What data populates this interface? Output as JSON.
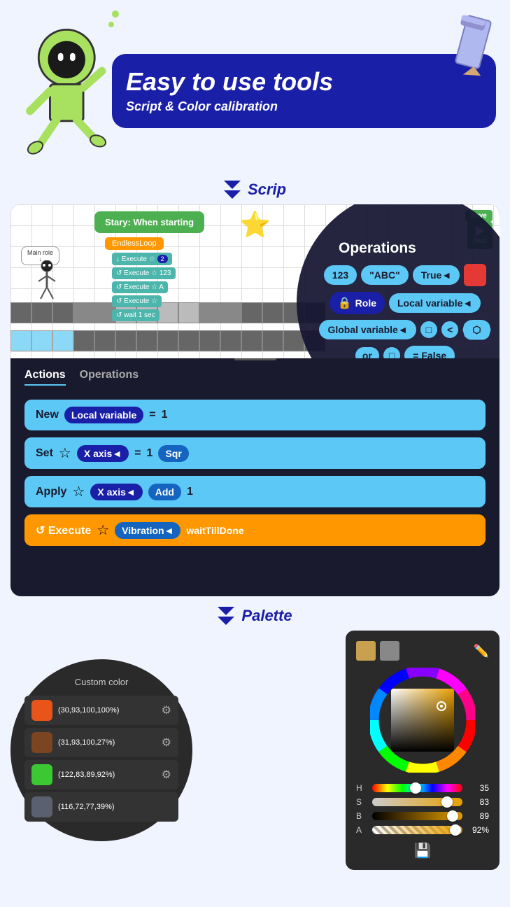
{
  "header": {
    "title_main": "Easy to use tools",
    "title_sub": "Script & Color calibration"
  },
  "sections": {
    "script_label": "Scrip",
    "palette_label": "Palette"
  },
  "game": {
    "start_block": "Stary: When starting",
    "loop_block": "EndlessLoop",
    "save_btn": "Save",
    "test_btn": "Test",
    "main_role": "Main role",
    "execute_rows": [
      {
        "label": "↓ Execute",
        "extra": "2"
      },
      {
        "label": "↺ Execute",
        "extra": "123"
      },
      {
        "label": "↺ Execute",
        "extra": "A"
      },
      {
        "label": "↺ Execute",
        "extra": ""
      },
      {
        "label": "↺ wait 1 sec",
        "extra": ""
      }
    ]
  },
  "operations": {
    "title": "Operations",
    "row1": [
      "123",
      "\"ABC\"",
      "True◄",
      "■"
    ],
    "row2": [
      "Role",
      "Local variable◄"
    ],
    "row3": [
      "Global variable◄",
      "□",
      "<",
      "⬡"
    ],
    "row4": [
      "or",
      "□",
      "= False"
    ]
  },
  "tabs": {
    "actions_label": "Actions",
    "operations_label": "Operations"
  },
  "actions": [
    {
      "type": "new_var",
      "text": "New Local variable = 1"
    },
    {
      "type": "set",
      "prefix": "Set",
      "role": "☆",
      "axis": "X axis◄",
      "eq": "=",
      "num": "1",
      "fn": "Sqr"
    },
    {
      "type": "apply",
      "prefix": "Apply",
      "role": "☆",
      "axis": "X axis◄",
      "fn": "Add",
      "num": "1"
    },
    {
      "type": "execute",
      "prefix": "↺ Execute",
      "role": "☆",
      "target": "Vibration◄",
      "fn": "waitTillDone"
    }
  ],
  "custom_colors": {
    "title": "Custom color",
    "items": [
      {
        "color": "#e8541a",
        "label": "(30,93,100,100%)"
      },
      {
        "color": "#7a4520",
        "label": "(31,93,100,27%)"
      },
      {
        "color": "#3cc832",
        "label": "(122,83,89,92%)"
      },
      {
        "color": "#5a6070",
        "label": "(116,72,77,39%)"
      }
    ]
  },
  "color_picker": {
    "sliders": [
      {
        "label": "H",
        "value": "35",
        "pct": 0.48
      },
      {
        "label": "S",
        "value": "83",
        "pct": 0.83
      },
      {
        "label": "B",
        "value": "89",
        "pct": 0.89
      },
      {
        "label": "A",
        "value": "92%",
        "pct": 0.92
      }
    ]
  }
}
